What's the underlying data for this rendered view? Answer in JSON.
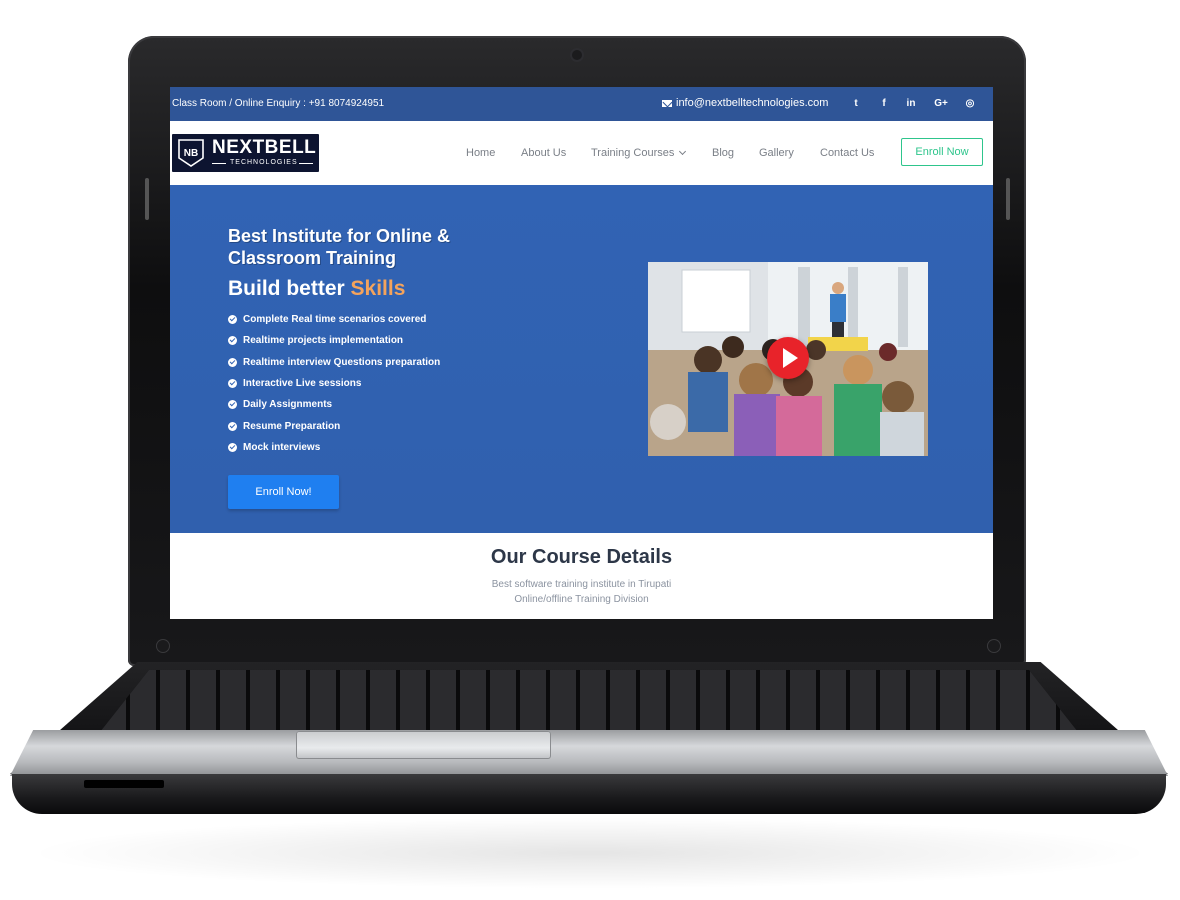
{
  "topbar": {
    "enquiry": "Class Room / Online Enquiry : +91 8074924951",
    "email": "info@nextbelltechnologies.com",
    "social_icons": [
      "twitter-icon",
      "facebook-icon",
      "linkedin-icon",
      "google-plus-icon",
      "instagram-icon"
    ],
    "social_glyphs": {
      "twitter": "t",
      "facebook": "f",
      "linkedin": "in",
      "googleplus": "G+",
      "instagram": "◎"
    }
  },
  "logo": {
    "name": "NEXTBELL",
    "sub": "TECHNOLOGIES",
    "mark": "NB"
  },
  "nav": {
    "items": [
      "Home",
      "About Us",
      "Training Courses",
      "Blog",
      "Gallery",
      "Contact Us"
    ],
    "enroll": "Enroll Now"
  },
  "hero": {
    "title": "Best Institute for Online & Classroom Training",
    "subtitle_prefix": "Build better",
    "subtitle_accent": "Skills",
    "features": [
      "Complete Real time scenarios covered",
      "Realtime projects implementation",
      "Realtime interview Questions preparation",
      "Interactive Live sessions",
      "Daily Assignments",
      "Resume Preparation",
      "Mock interviews"
    ],
    "button": "Enroll Now!"
  },
  "course": {
    "title": "Our Course Details",
    "line1": "Best software training institute in Tirupati",
    "line2": "Online/offline Training Division"
  },
  "colors": {
    "topbar": "#2f5597",
    "hero": "#3163b4",
    "accent": "#f4a35c",
    "enroll_outline": "#2ec58c",
    "hero_button": "#1f7ff0",
    "play": "#e8232a"
  }
}
